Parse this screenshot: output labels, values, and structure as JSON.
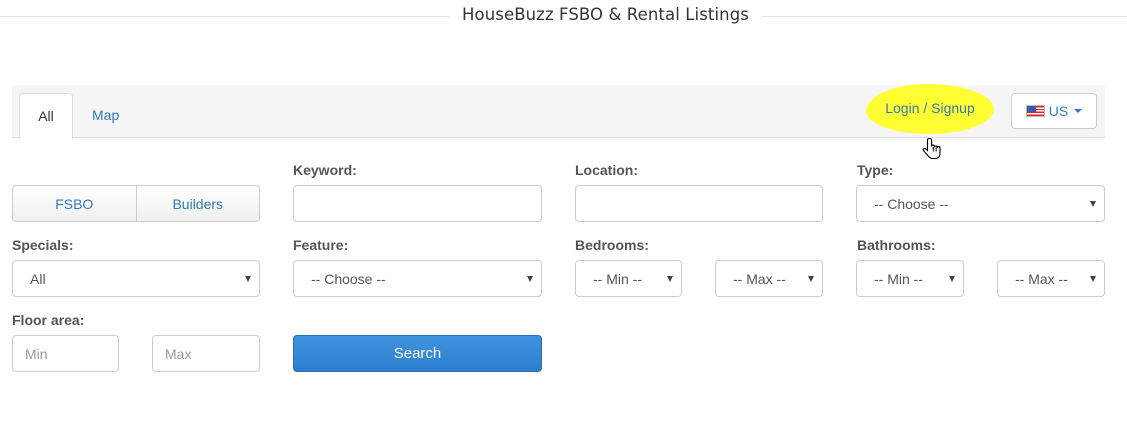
{
  "header": {
    "title": "HouseBuzz FSBO & Rental Listings"
  },
  "nav": {
    "tabs": [
      {
        "label": "All"
      },
      {
        "label": "Map"
      }
    ],
    "login_label": "Login / Signup",
    "country_label": "US"
  },
  "colors": {
    "link": "#337ab7",
    "highlight": "#ffff33",
    "primary": "#337ab7"
  },
  "filters": {
    "listing_types": [
      {
        "label": "FSBO"
      },
      {
        "label": "Builders"
      }
    ],
    "keyword": {
      "label": "Keyword:",
      "value": "",
      "placeholder": ""
    },
    "location": {
      "label": "Location:",
      "value": "",
      "placeholder": ""
    },
    "type": {
      "label": "Type:",
      "selected": "-- Choose --"
    },
    "specials": {
      "label": "Specials:",
      "selected": "All"
    },
    "feature": {
      "label": "Feature:",
      "selected": "-- Choose --"
    },
    "bedrooms": {
      "label": "Bedrooms:",
      "min": "-- Min --",
      "max": "-- Max --"
    },
    "bathrooms": {
      "label": "Bathrooms:",
      "min": "-- Min --",
      "max": "-- Max --"
    },
    "floor_area": {
      "label": "Floor area:",
      "min_placeholder": "Min",
      "max_placeholder": "Max"
    },
    "search_label": "Search"
  },
  "icons": {
    "flag": "us-flag-icon",
    "caret": "caret-down-icon",
    "cursor": "hand-cursor-icon"
  }
}
